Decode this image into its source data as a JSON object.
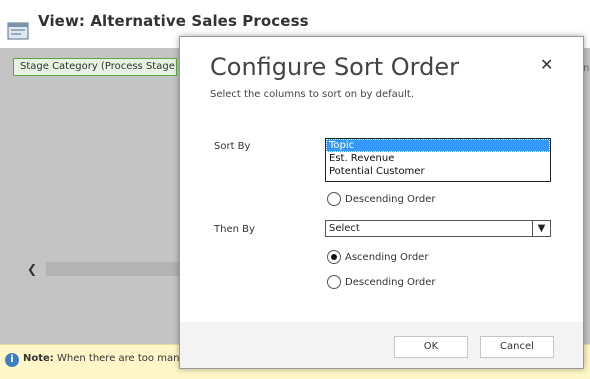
{
  "page": {
    "title": "View: Alternative Sales Process",
    "stage_column": "Stage Category (Process Stage)",
    "right_edge_fragment": "n",
    "note_label": "Note:",
    "note_text": "When there are too many c"
  },
  "dialog": {
    "title": "Configure Sort Order",
    "subtitle": "Select the columns to sort on by default.",
    "sort_by_label": "Sort By",
    "sort_by_options": [
      "Topic",
      "Est. Revenue",
      "Potential Customer"
    ],
    "sort_by_selected": "Topic",
    "sort_desc_label": "Descending Order",
    "then_by_label": "Then By",
    "then_by_value": "Select",
    "then_asc_label": "Ascending Order",
    "then_desc_label": "Descending Order",
    "then_order_selected": "Ascending Order",
    "ok_label": "OK",
    "cancel_label": "Cancel"
  },
  "icons": {
    "close": "close-icon",
    "view": "view-icon",
    "info": "info-icon",
    "chevron_left": "chevron-left-icon",
    "dropdown": "chevron-down-icon"
  },
  "colors": {
    "selection": "#3399ff",
    "stage_border": "#5faa3e",
    "note_bg": "#fff7c8",
    "info_icon": "#3f7fc1"
  }
}
